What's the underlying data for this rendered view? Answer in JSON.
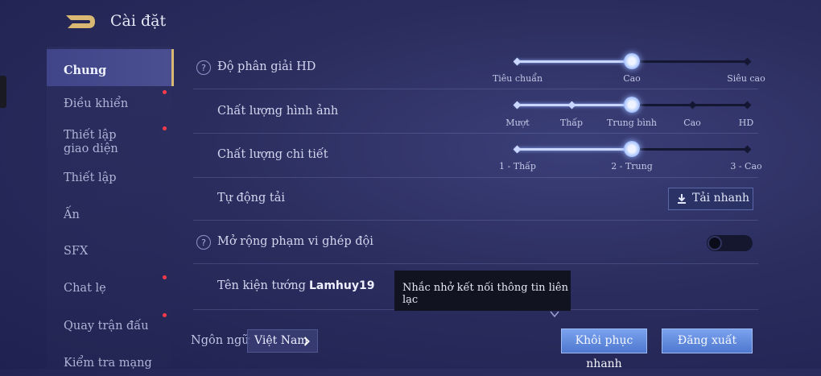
{
  "header": {
    "title": "Cài đặt",
    "back_icon": "back-arrow-icon"
  },
  "sidebar": {
    "items": [
      {
        "label": "Chung",
        "active": true,
        "notification": false
      },
      {
        "label": "Điều khiển",
        "notification": true
      },
      {
        "label": "Thiết lập giao diện",
        "notification": true
      },
      {
        "label": "Thiết lập",
        "notification": false
      },
      {
        "label": "Ấn",
        "notification": false
      },
      {
        "label": "SFX",
        "notification": false
      },
      {
        "label": "Chat lẹ",
        "notification": true
      },
      {
        "label": "Quay trận đấu",
        "notification": true
      },
      {
        "label": "Kiểm tra mạng",
        "notification": false
      }
    ]
  },
  "settings": {
    "resolution": {
      "label": "Độ phân giải HD",
      "options": [
        "Tiêu chuẩn",
        "Cao",
        "Siêu cao"
      ],
      "selected": "Cao"
    },
    "image_quality": {
      "label": "Chất lượng hình ảnh",
      "options": [
        "Mượt",
        "Thấp",
        "Trung bình",
        "Cao",
        "HD"
      ],
      "selected": "Trung bình"
    },
    "detail_quality": {
      "label": "Chất lượng chi tiết",
      "options": [
        "1 - Thấp",
        "2 - Trung",
        "3 - Cao"
      ],
      "selected": "2 - Trung"
    },
    "auto_download": {
      "label": "Tự động tải",
      "button_label": "Tải nhanh"
    },
    "team_matching": {
      "label": "Mở rộng phạm vi ghép đội",
      "enabled": false
    },
    "hero_name": {
      "label": "Tên kiện tướng",
      "value": "Lamhuy19"
    }
  },
  "tooltip": {
    "text": "Nhắc nhở kết nối thông tin liên lạc"
  },
  "footer": {
    "language_label": "Ngôn ngữ",
    "language_value": "Việt Nam",
    "quick_restore_label": "Khôi phục nhanh",
    "logout_label": "Đăng xuất"
  },
  "colors": {
    "accent": "#d9b873",
    "button_blue": "#5f86d8",
    "notification": "#ff3a4a"
  }
}
